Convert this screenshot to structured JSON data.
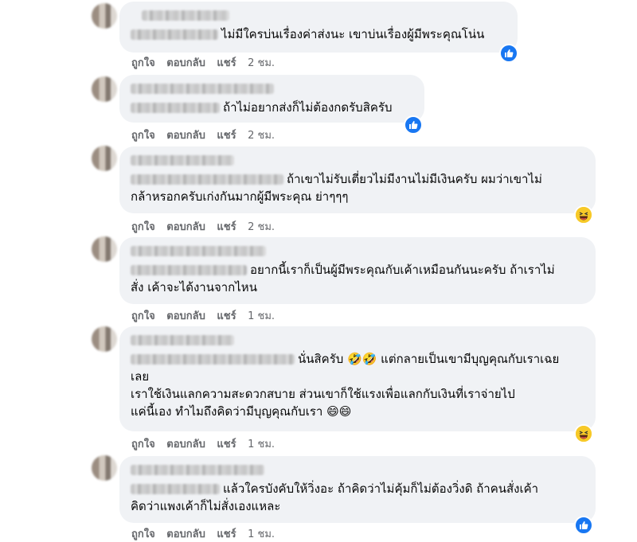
{
  "actions": {
    "like": "ถูกใจ",
    "reply": "ตอบกลับ",
    "share": "แชร์"
  },
  "comments": [
    {
      "text": "ไม่มีใครบ่นเรื่องค่าส่งนะ เขาบ่นเรื่องผู้มีพระคุณโน่น",
      "time": "2 ชม.",
      "reaction": "like-icon"
    },
    {
      "text": "ถ้าไม่อยากส่งก็ไม่ต้องกดรับสิครับ",
      "time": "2 ชม.",
      "reaction": "like-icon"
    },
    {
      "line1": "ถ้าเขาไม่รับเตี่ยวไม่มีงานไม่มีเงินครับ ผมว่าเขาไม่",
      "line2": "กล้าหรอกครับเก่งกันมากผู้มีพระคุณ ย่าๆๆๆ",
      "time": "2 ชม.",
      "reaction": "haha-icon"
    },
    {
      "line1": "อยากนี้เราก็เป็นผู้มีพระคุณกับเค้าเหมือนกันนะครับ ถ้าเราไม่",
      "line2": "สั่ง เค้าจะได้งานจากไหน",
      "time": "1 ชม."
    },
    {
      "line1": "นั่นสิครับ 🤣🤣 แต่กลายเป็นเขามีบุญคุณกับเราเฉย",
      "line2": "เลย",
      "line3": "เราใช้เงินแลกความสะดวกสบาย ส่วนเขาก็ใช้แรงเพื่อแลกกับเงินที่เราจ่ายไป",
      "line4": "แค่นี้เอง ทำไมถึงคิดว่ามีบุญคุณกับเรา 😄😄",
      "time": "1 ชม.",
      "reaction": "haha-icon"
    },
    {
      "line1": "แล้วใครบังคับให้วิ่งอะ ถ้าคิดว่าไม่คุ้มก็ไม่ต้องวิ่งดิ ถ้าคนสั่งเค้า",
      "line2": "คิดว่าแพงเค้าก็ไม่สั่งเองแหละ",
      "time": "1 ชม.",
      "reaction": "like-icon"
    }
  ]
}
